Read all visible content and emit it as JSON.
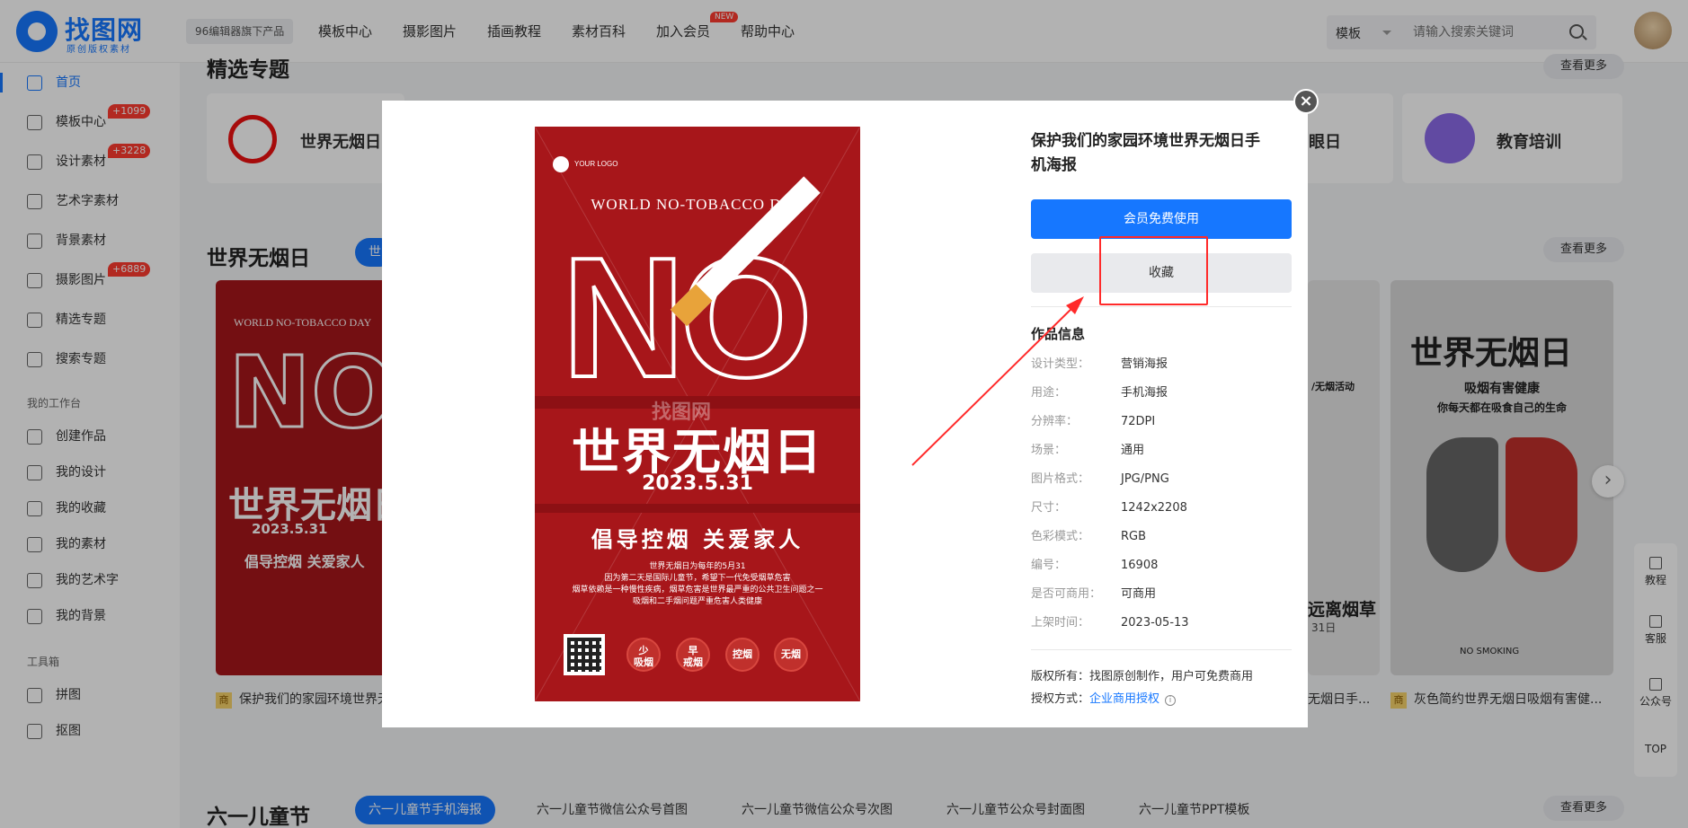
{
  "header": {
    "logo_title": "找图网",
    "logo_sub": "原创版权素材",
    "brand_chip": "96编辑器旗下产品",
    "nav": [
      "模板中心",
      "摄影图片",
      "插画教程",
      "素材百科",
      "加入会员",
      "帮助中心"
    ],
    "new_badge": "NEW",
    "search_type": "模板",
    "search_placeholder": "请输入搜索关键词"
  },
  "sidebar": {
    "items": [
      {
        "label": "首页",
        "badge": ""
      },
      {
        "label": "模板中心",
        "badge": "+1099"
      },
      {
        "label": "设计素材",
        "badge": "+3228"
      },
      {
        "label": "艺术字素材",
        "badge": ""
      },
      {
        "label": "背景素材",
        "badge": ""
      },
      {
        "label": "摄影图片",
        "badge": "+6889"
      },
      {
        "label": "精选专题",
        "badge": ""
      },
      {
        "label": "搜索专题",
        "badge": ""
      }
    ],
    "workbench_label": "我的工作台",
    "workbench": [
      "创建作品",
      "我的设计",
      "我的收藏",
      "我的素材",
      "我的艺术字",
      "我的背景"
    ],
    "tools_label": "工具箱",
    "tools": [
      "拼图",
      "抠图"
    ]
  },
  "main": {
    "section1_title": "精选专题",
    "more_label": "查看更多",
    "topics": [
      "世界无烟日",
      "眼日",
      "教育培训"
    ],
    "section2_title": "世界无烟日",
    "section2_pill": "世",
    "captions": [
      "保护我们的家园环境世界无",
      "无烟日手...",
      "灰色简约世界无烟日吸烟有害健..."
    ],
    "caption_tag": "商",
    "section3_title": "六一儿童节",
    "section3_pills": [
      "六一儿童节手机海报",
      "六一儿童节微信公众号首图",
      "六一儿童节微信公众号次图",
      "六一儿童节公众号封面图",
      "六一儿童节PPT模板"
    ],
    "right_card_texts": {
      "title": "世界无烟日",
      "sub1": "吸烟有害健康",
      "sub2": "你每天都在吸食自己的生命",
      "foot": "NO SMOKING"
    },
    "mid_card_texts": {
      "a": "/无烟活动",
      "b": "远离烟草",
      "c": "31日"
    }
  },
  "floatbar": [
    "教程",
    "客服",
    "公众号",
    "TOP"
  ],
  "modal": {
    "close": "×",
    "poster": {
      "logo": "YOUR LOGO",
      "english": "WORLD NO-TOBACCO DAY",
      "big": "NO",
      "cn_title": "世界无烟日",
      "date": "2023.5.31",
      "slogan": "倡导控烟 关爱家人",
      "desc": [
        "世界无烟日为每年的5月31",
        "因为第二天是国际儿童节，希望下一代免受烟草危害",
        "烟草依赖是一种慢性疾病，烟草危害是世界最严重的公共卫生问题之一",
        "吸烟和二手烟问题严重危害人类健康"
      ],
      "circles": [
        [
          "少",
          "吸烟"
        ],
        [
          "早",
          "戒烟"
        ],
        [
          "控烟"
        ],
        [
          "无烟"
        ]
      ],
      "watermark": "找图网"
    },
    "title": "保护我们的家园环境世界无烟日手机海报",
    "btn_member": "会员免费使用",
    "btn_fav": "收藏",
    "info_heading": "作品信息",
    "info": [
      {
        "k": "设计类型：",
        "v": "营销海报"
      },
      {
        "k": "用途：",
        "v": "手机海报"
      },
      {
        "k": "分辨率：",
        "v": "72DPI"
      },
      {
        "k": "场景：",
        "v": "通用"
      },
      {
        "k": "图片格式：",
        "v": "JPG/PNG"
      },
      {
        "k": "尺寸：",
        "v": "1242x2208"
      },
      {
        "k": "色彩模式：",
        "v": "RGB"
      },
      {
        "k": "编号：",
        "v": "16908"
      },
      {
        "k": "是否可商用：",
        "v": "可商用"
      },
      {
        "k": "上架时间：",
        "v": "2023-05-13"
      }
    ],
    "copyright": "版权所有：找图原创制作，用户可免费商用",
    "license_label": "授权方式：",
    "license_link": "企业商用授权"
  },
  "colors": {
    "accent": "#1677ff",
    "poster_red": "#a7161a",
    "highlight": "#ff2a2a"
  }
}
